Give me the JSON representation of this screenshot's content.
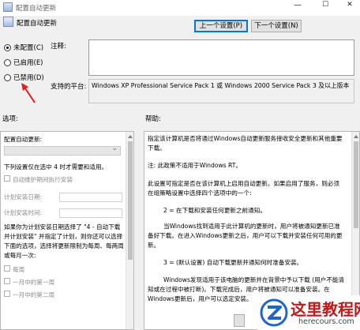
{
  "window": {
    "title": "配置自动更新",
    "minimize": "—",
    "maximize": "☐",
    "close": "✕"
  },
  "header": {
    "title": "配置自动更新"
  },
  "nav": {
    "prev_label": "上一个设置(P)",
    "next_label": "下一个设置(N)"
  },
  "state": {
    "options": [
      {
        "label": "未配置(C)",
        "selected": true
      },
      {
        "label": "已启用(E)",
        "selected": false
      },
      {
        "label": "已禁用(D)",
        "selected": false
      }
    ]
  },
  "comment": {
    "label": "注释:",
    "value": ""
  },
  "supported": {
    "label": "支持的平台:",
    "value": "Windows XP Professional Service Pack 1 或 Windows 2000 Service Pack 3 及以上版本"
  },
  "options_panel": {
    "heading": "选项:",
    "configure_label": "配置自动更新:",
    "configure_value": "",
    "intro": "下列设置仅在选中 4 时才需要和适用。",
    "maintenance_checkbox": "自动维护期间执行安装",
    "schedule_day_label": "计划安装日期:",
    "schedule_time_label": "计划安装时间:",
    "note_lines": [
      "如果你为计划安装日期选择了 \"4 - 自动下载",
      "并计划安装\" 并指定了计划，则你还可以选择",
      "下面的选项，选择将更新限制为每周、每两周",
      "或每月一次:"
    ],
    "weekly_checkbox": "每周",
    "month_first_checkbox": "一月中的第一周",
    "month_second_checkbox": "一月中的第二周"
  },
  "help_panel": {
    "heading": "帮助:",
    "p1": "指定该计算机是否将通过Windows自动更新服务接收安全更新和其他重要下载。",
    "p2": "注: 此政策不适用于Windows RT。",
    "p3": "此设置可指定是否在该计算机上启用自动更新。如果启用了服务，则必须在组策略设置中选择四个选项中的一个:",
    "p4": "2 = 在下载和安装任何更新之前通知。",
    "p5": "当Windows找到适用于此计算机的更新时，用户将被通知更新已准备好下载。在进入Windows更新之后，用户可以下载并安装任何可用的更新。",
    "p6": "3 = (默认设置) 自动下载更新并通知何时准备安装。",
    "p7": "Windows发现适用于该电脑的更新并在背景中予以下载 (用户不能清知或在过程中被打断)。下载完成后，用户将被通知可以准备安装。在Windows更新后，用户可以选定安装。"
  },
  "watermark": {
    "text": "这里教程网",
    "url": "herecours.com",
    "color": "#c41818"
  },
  "colors": {
    "accent": "#0078d7",
    "arrow": "#e02020"
  }
}
